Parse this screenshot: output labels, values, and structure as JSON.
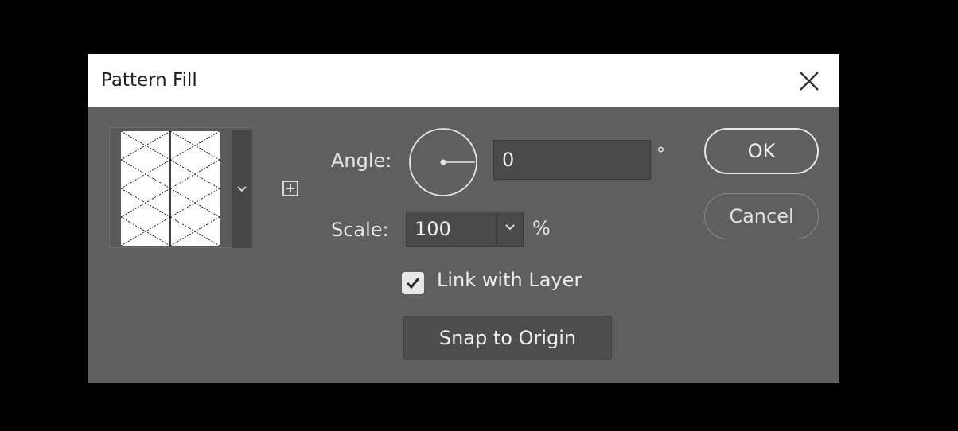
{
  "dialog": {
    "title": "Pattern Fill"
  },
  "icons": {
    "close": "close-icon",
    "pattern_dropdown": "chevron-down-icon",
    "new_preset": "plus-square-icon",
    "scale_dropdown": "chevron-down-icon",
    "check": "checkmark-icon"
  },
  "angle": {
    "label": "Angle:",
    "value": "0",
    "unit": "°"
  },
  "scale": {
    "label": "Scale:",
    "value": "100",
    "unit": "%"
  },
  "link_with_layer": {
    "label": "Link with Layer",
    "checked": true
  },
  "buttons": {
    "snap_to_origin": "Snap to Origin",
    "ok": "OK",
    "cancel": "Cancel"
  },
  "colors": {
    "dialog_bg": "#5f5f5f",
    "titlebar_bg": "#ffffff",
    "field_bg": "#4a4a4a",
    "text": "#e6e6e6"
  }
}
